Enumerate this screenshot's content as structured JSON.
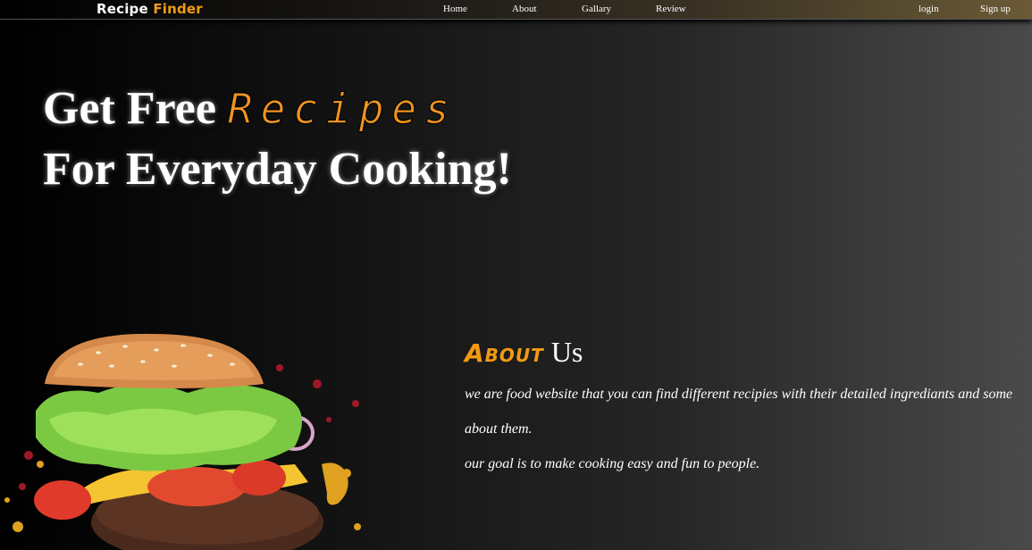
{
  "brand": {
    "part1": "Recipe",
    "part2": "Finder"
  },
  "nav": {
    "links": [
      "Home",
      "About",
      "Gallary",
      "Review"
    ],
    "auth": [
      "login",
      "Sign up"
    ]
  },
  "hero": {
    "line1_prefix": "Get Free",
    "line1_accent": "Recipes",
    "line2": "For Everyday Cooking!"
  },
  "about": {
    "title_accent": "About",
    "title_rest": "Us",
    "paragraph1_line1": "we are food website that you can find different recipies with their detailed ingrediants and some",
    "paragraph1_line2": "about them.",
    "paragraph2": "our goal is to make cooking easy and fun to people."
  },
  "colors": {
    "accent": "#f39c12",
    "background": "#1a1a1a",
    "text": "#ffffff"
  },
  "image": {
    "hero_image": "burger"
  }
}
